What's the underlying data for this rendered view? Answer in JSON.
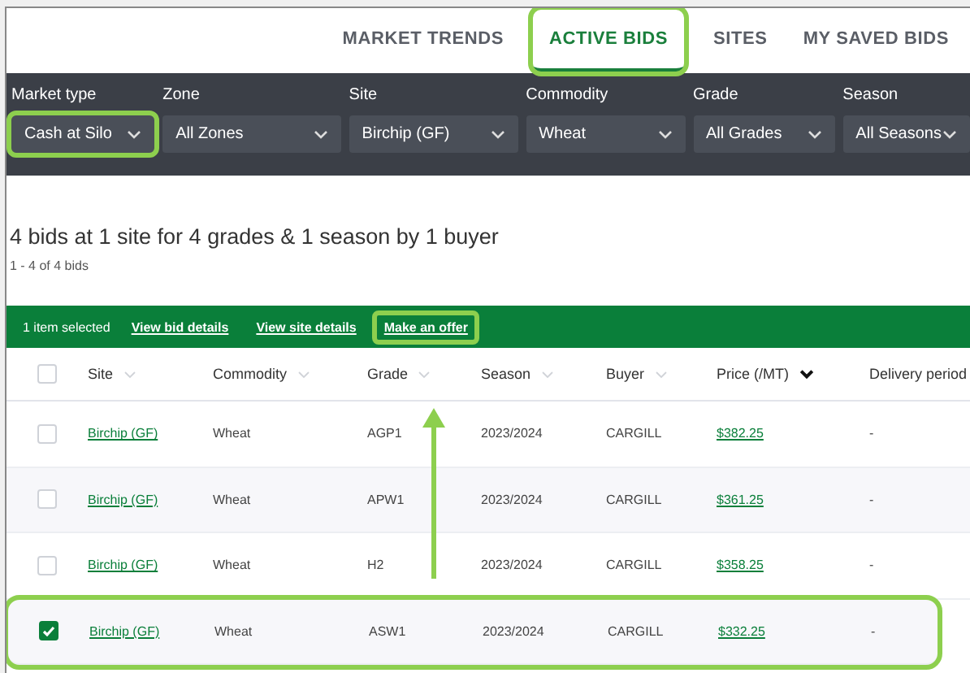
{
  "tabs": [
    {
      "label": "MARKET TRENDS",
      "selected": false,
      "highlighted": false
    },
    {
      "label": "ACTIVE BIDS",
      "selected": true,
      "highlighted": true
    },
    {
      "label": "SITES",
      "selected": false,
      "highlighted": false
    },
    {
      "label": "MY SAVED BIDS",
      "selected": false,
      "highlighted": false
    }
  ],
  "filters": [
    {
      "label": "Market type",
      "value": "Cash at Silo",
      "highlighted": true
    },
    {
      "label": "Zone",
      "value": "All Zones",
      "highlighted": false
    },
    {
      "label": "Site",
      "value": "Birchip (GF)",
      "highlighted": false
    },
    {
      "label": "Commodity",
      "value": "Wheat",
      "highlighted": false
    },
    {
      "label": "Grade",
      "value": "All Grades",
      "highlighted": false
    },
    {
      "label": "Season",
      "value": "All Seasons",
      "highlighted": false
    }
  ],
  "summary": {
    "title": "4 bids at 1 site for 4 grades & 1 season by 1 buyer",
    "count": "1 - 4 of 4 bids"
  },
  "action_bar": {
    "selection": "1 item selected",
    "actions": [
      {
        "label": "View bid details",
        "highlighted": false
      },
      {
        "label": "View site details",
        "highlighted": false
      },
      {
        "label": "Make an offer",
        "highlighted": true
      }
    ]
  },
  "table": {
    "columns": [
      {
        "label": "Site",
        "sorted": false
      },
      {
        "label": "Commodity",
        "sorted": false
      },
      {
        "label": "Grade",
        "sorted": false
      },
      {
        "label": "Season",
        "sorted": false
      },
      {
        "label": "Buyer",
        "sorted": false
      },
      {
        "label": "Price (/MT)",
        "sorted": true
      },
      {
        "label": "Delivery period"
      }
    ],
    "select_all_checked": false,
    "rows": [
      {
        "checked": false,
        "highlighted": false,
        "cells": [
          "Birchip (GF)",
          "Wheat",
          "AGP1",
          "2023/2024",
          "CARGILL",
          "$382.25",
          "-"
        ]
      },
      {
        "checked": false,
        "highlighted": false,
        "cells": [
          "Birchip (GF)",
          "Wheat",
          "APW1",
          "2023/2024",
          "CARGILL",
          "$361.25",
          "-"
        ]
      },
      {
        "checked": false,
        "highlighted": false,
        "cells": [
          "Birchip (GF)",
          "Wheat",
          "H2",
          "2023/2024",
          "CARGILL",
          "$358.25",
          "-"
        ]
      },
      {
        "checked": true,
        "highlighted": true,
        "cells": [
          "Birchip (GF)",
          "Wheat",
          "ASW1",
          "2023/2024",
          "CARGILL",
          "$332.25",
          "-"
        ]
      }
    ]
  }
}
